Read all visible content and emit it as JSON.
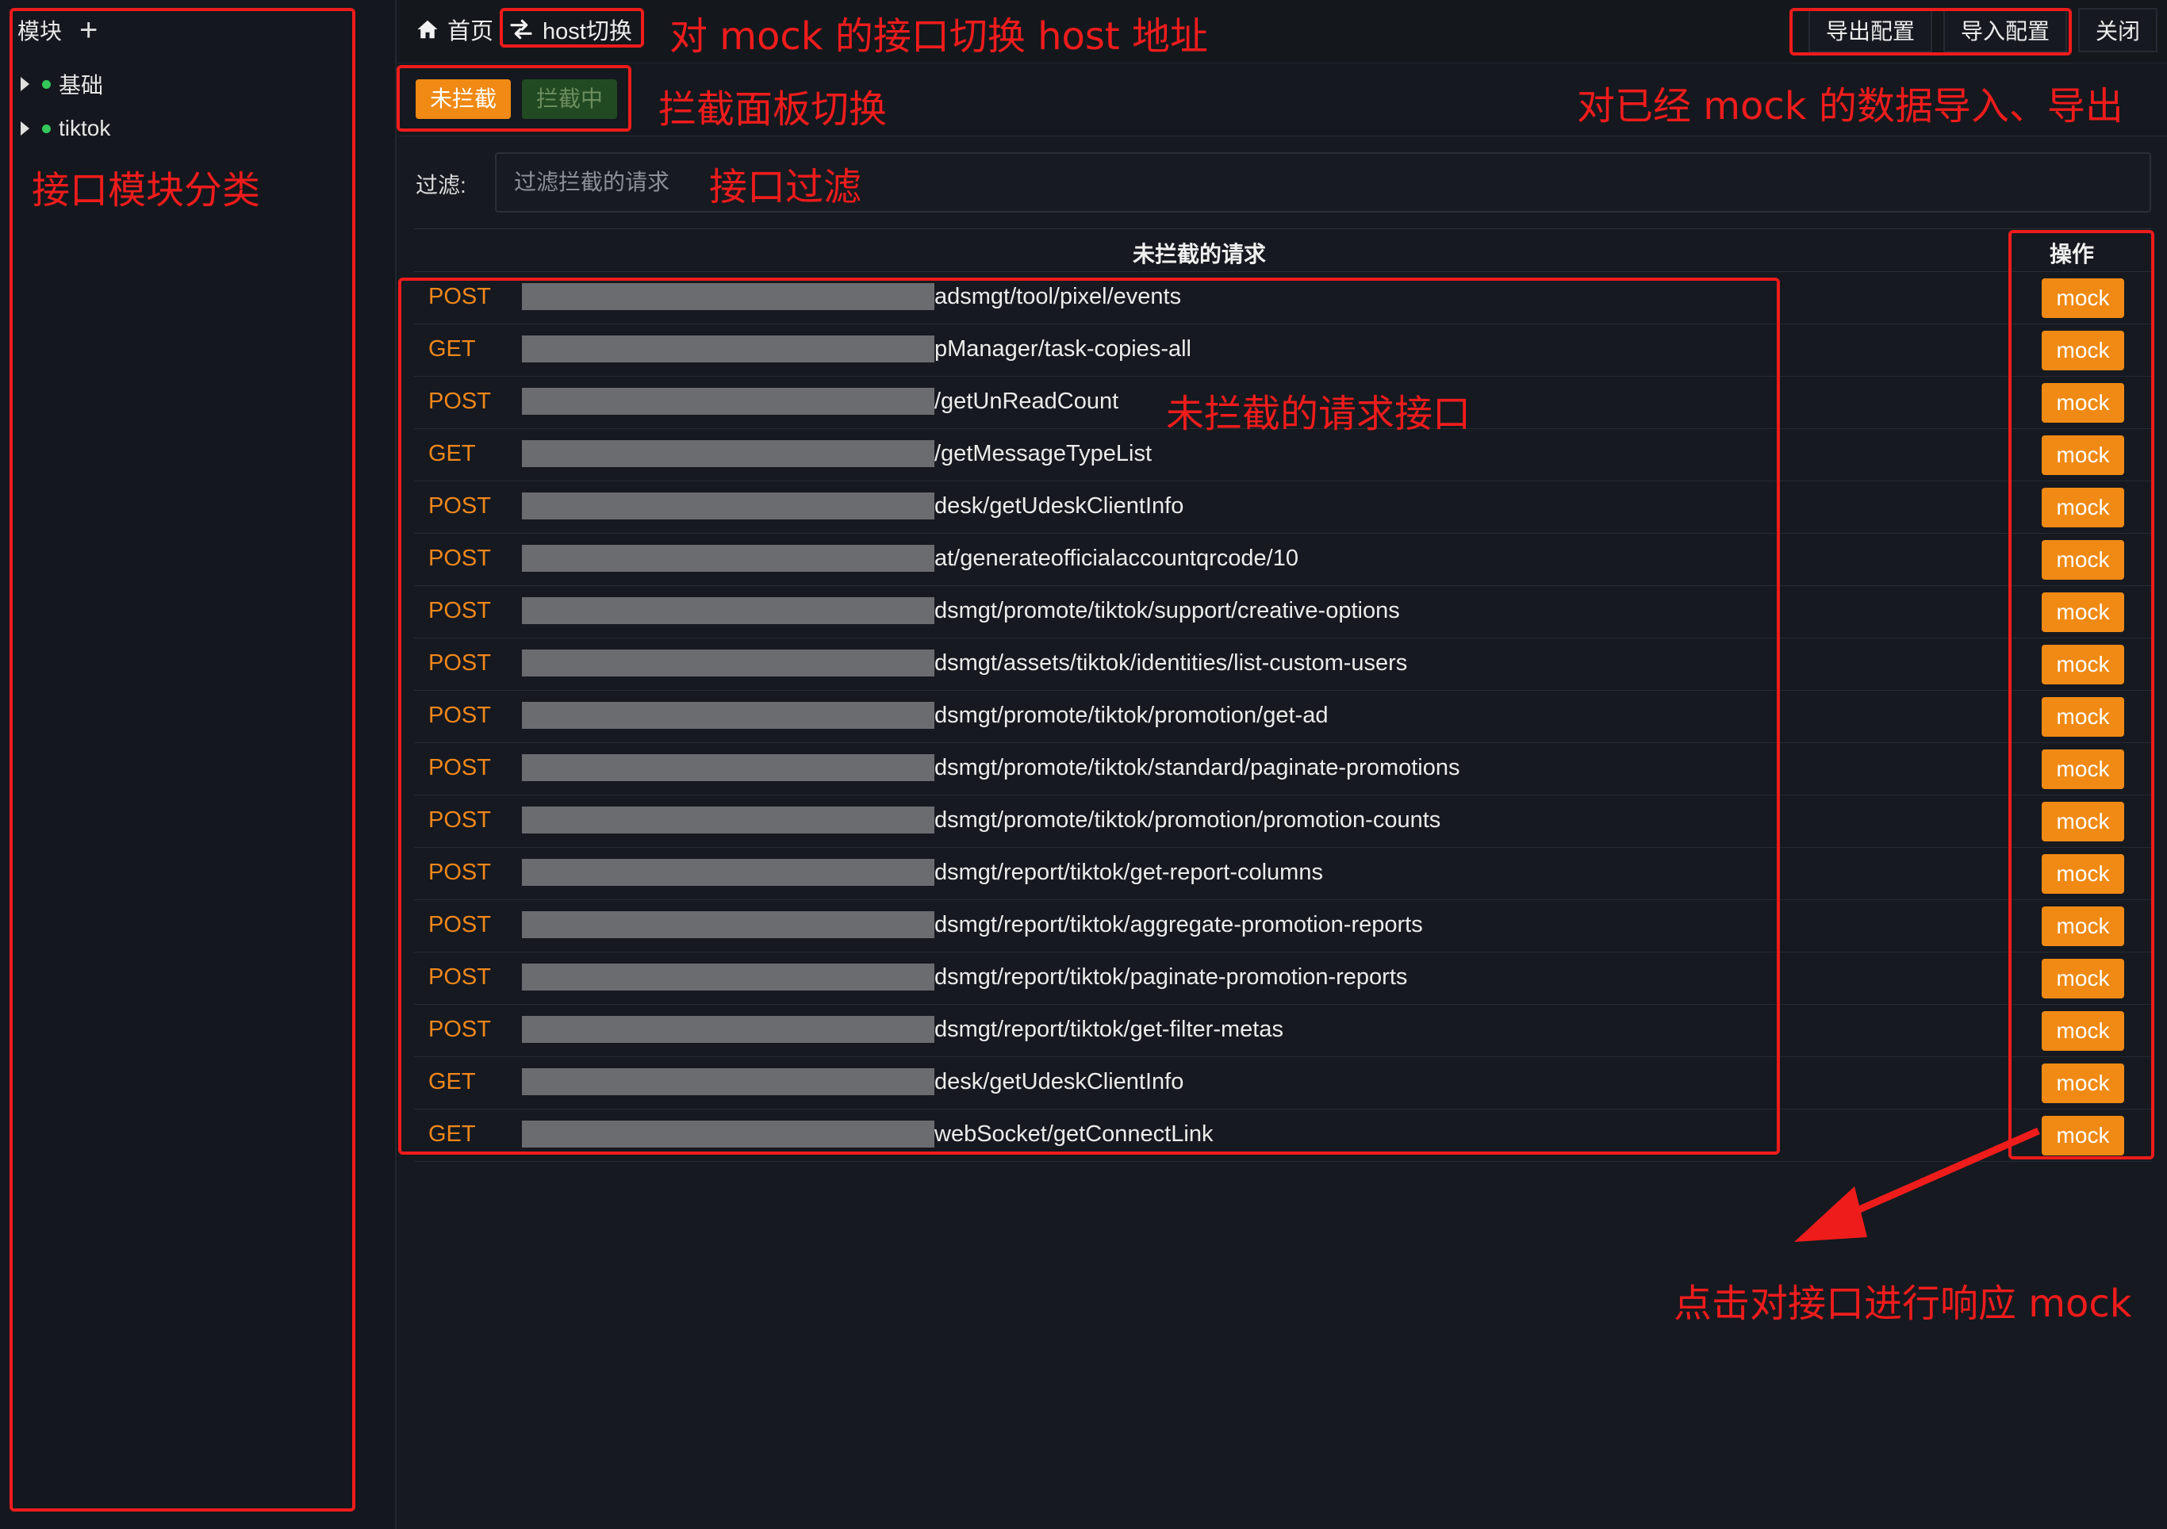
{
  "sidebar": {
    "title": "模块",
    "add_icon": "plus-icon",
    "modules": [
      {
        "label": "基础",
        "status_color": "#34c759"
      },
      {
        "label": "tiktok",
        "status_color": "#34c759"
      }
    ]
  },
  "header": {
    "home_label": "首页",
    "host_switch_label": "host切换",
    "export_label": "导出配置",
    "import_label": "导入配置",
    "close_label": "关闭"
  },
  "tabs": {
    "not_intercepted": "未拦截",
    "intercepting": "拦截中"
  },
  "filter": {
    "label": "过滤:",
    "placeholder": "过滤拦截的请求",
    "value": ""
  },
  "table": {
    "header_main": "未拦截的请求",
    "header_op": "操作",
    "rows": [
      {
        "method": "POST",
        "path": "adsmgt/tool/pixel/events",
        "action": "mock"
      },
      {
        "method": "GET",
        "path": "pManager/task-copies-all",
        "action": "mock"
      },
      {
        "method": "POST",
        "path": "/getUnReadCount",
        "action": "mock"
      },
      {
        "method": "GET",
        "path": "/getMessageTypeList",
        "action": "mock"
      },
      {
        "method": "POST",
        "path": "desk/getUdeskClientInfo",
        "action": "mock"
      },
      {
        "method": "POST",
        "path": "at/generateofficialaccountqrcode/10",
        "action": "mock"
      },
      {
        "method": "POST",
        "path": "dsmgt/promote/tiktok/support/creative-options",
        "action": "mock"
      },
      {
        "method": "POST",
        "path": "dsmgt/assets/tiktok/identities/list-custom-users",
        "action": "mock"
      },
      {
        "method": "POST",
        "path": "dsmgt/promote/tiktok/promotion/get-ad",
        "action": "mock"
      },
      {
        "method": "POST",
        "path": "dsmgt/promote/tiktok/standard/paginate-promotions",
        "action": "mock"
      },
      {
        "method": "POST",
        "path": "dsmgt/promote/tiktok/promotion/promotion-counts",
        "action": "mock"
      },
      {
        "method": "POST",
        "path": "dsmgt/report/tiktok/get-report-columns",
        "action": "mock"
      },
      {
        "method": "POST",
        "path": "dsmgt/report/tiktok/aggregate-promotion-reports",
        "action": "mock"
      },
      {
        "method": "POST",
        "path": "dsmgt/report/tiktok/paginate-promotion-reports",
        "action": "mock"
      },
      {
        "method": "POST",
        "path": "dsmgt/report/tiktok/get-filter-metas",
        "action": "mock"
      },
      {
        "method": "GET",
        "path": "desk/getUdeskClientInfo",
        "action": "mock"
      },
      {
        "method": "GET",
        "path": "webSocket/getConnectLink",
        "action": "mock"
      }
    ]
  },
  "annotations": {
    "host_note": "对 mock 的接口切换 host 地址",
    "tab_note": "拦截面板切换",
    "import_export_note": "对已经 mock 的数据导入、导出",
    "module_note": "接口模块分类",
    "filter_note": "接口过滤",
    "list_note": "未拦截的请求接口",
    "mock_note": "点击对接口进行响应 mock",
    "annotation_color": "#ef1c1c"
  },
  "colors": {
    "accent": "#f08a15",
    "method": "#f0871c",
    "intercepting_tab_bg": "#224a22",
    "background": "#16191f"
  }
}
